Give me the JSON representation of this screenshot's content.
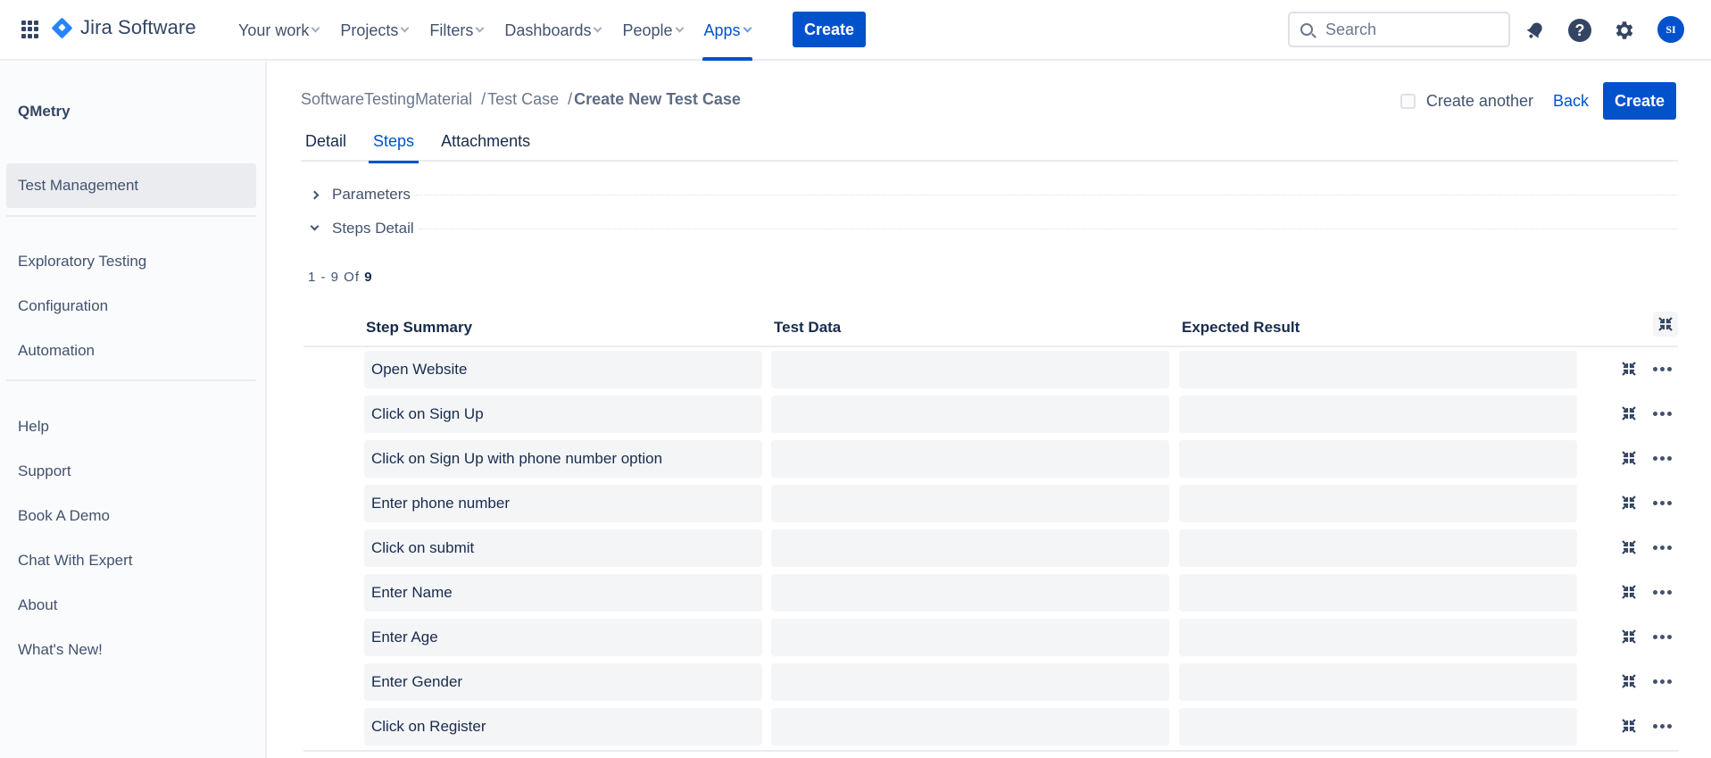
{
  "topnav": {
    "brand": "Jira Software",
    "items": [
      {
        "label": "Your work",
        "active": false
      },
      {
        "label": "Projects",
        "active": false
      },
      {
        "label": "Filters",
        "active": false
      },
      {
        "label": "Dashboards",
        "active": false
      },
      {
        "label": "People",
        "active": false
      },
      {
        "label": "Apps",
        "active": true
      }
    ],
    "create_label": "Create",
    "search_placeholder": "Search",
    "search_value": "",
    "help_glyph": "?",
    "avatar_initials": "SI",
    "accent_color": "#0052cc"
  },
  "sidebar": {
    "title": "QMetry",
    "primary": [
      {
        "label": "Test Management",
        "selected": true
      }
    ],
    "secondary": [
      {
        "label": "Exploratory Testing"
      },
      {
        "label": "Configuration"
      },
      {
        "label": "Automation"
      }
    ],
    "links": [
      {
        "label": "Help"
      },
      {
        "label": "Support"
      },
      {
        "label": "Book A Demo"
      },
      {
        "label": "Chat With Expert"
      },
      {
        "label": "About"
      },
      {
        "label": "What's New!"
      }
    ]
  },
  "breadcrumb": {
    "items": [
      "SoftwareTestingMaterial",
      "Test Case"
    ],
    "separator": "/",
    "current": "Create New Test Case"
  },
  "actions": {
    "create_another_label": "Create another",
    "create_another_checked": false,
    "back_label": "Back",
    "create_label": "Create"
  },
  "tabs": [
    {
      "label": "Detail",
      "active": false
    },
    {
      "label": "Steps",
      "active": true
    },
    {
      "label": "Attachments",
      "active": false
    }
  ],
  "sections": {
    "parameters": {
      "label": "Parameters",
      "expanded": false
    },
    "steps_detail": {
      "label": "Steps Detail",
      "expanded": true
    }
  },
  "pager": {
    "range": "1 - 9 Of",
    "total": "9"
  },
  "table": {
    "columns": [
      "Step Summary",
      "Test Data",
      "Expected Result"
    ],
    "rows": [
      {
        "summary": "Open Website",
        "test_data": "",
        "expected": ""
      },
      {
        "summary": "Click on Sign Up",
        "test_data": "",
        "expected": ""
      },
      {
        "summary": "Click on Sign Up with phone number option",
        "test_data": "",
        "expected": ""
      },
      {
        "summary": "Enter phone number",
        "test_data": "",
        "expected": ""
      },
      {
        "summary": "Click on submit",
        "test_data": "",
        "expected": ""
      },
      {
        "summary": "Enter Name",
        "test_data": "",
        "expected": ""
      },
      {
        "summary": "Enter Age",
        "test_data": "",
        "expected": ""
      },
      {
        "summary": "Enter Gender",
        "test_data": "",
        "expected": ""
      },
      {
        "summary": "Click on Register",
        "test_data": "",
        "expected": ""
      }
    ]
  }
}
